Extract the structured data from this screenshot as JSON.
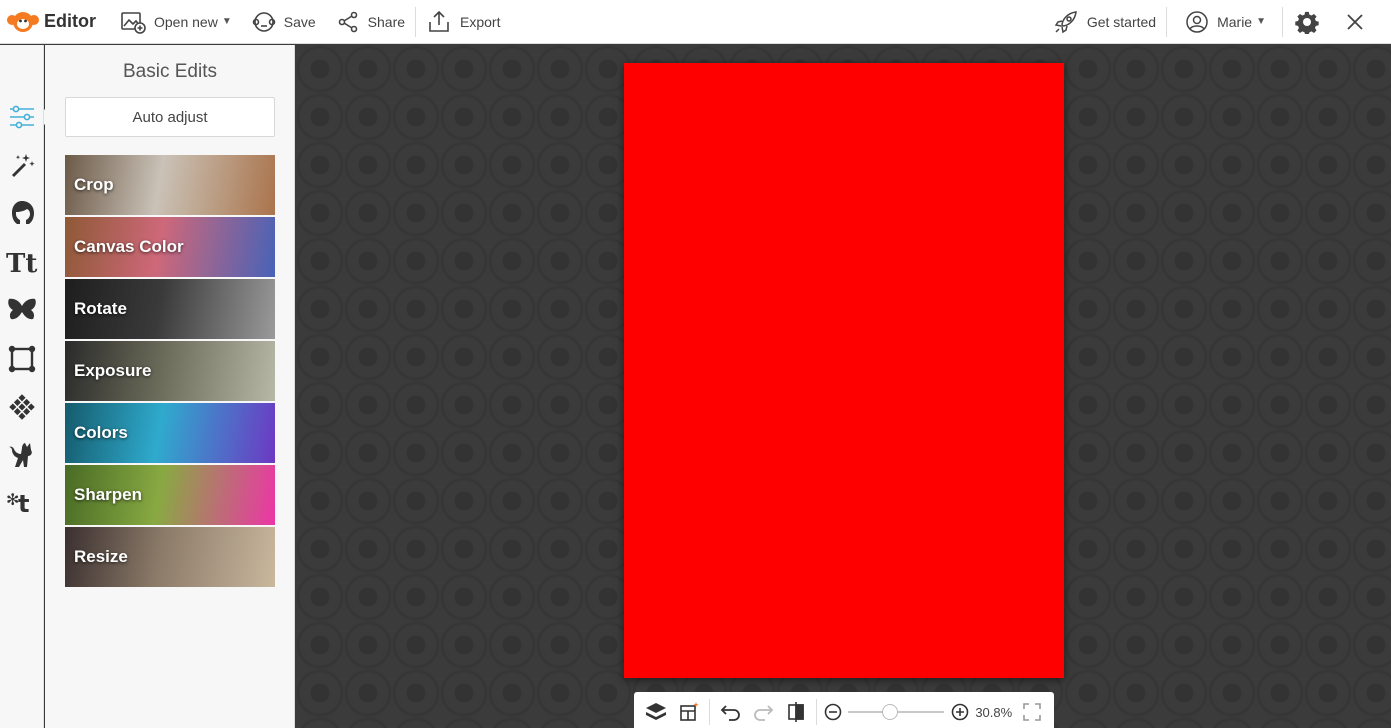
{
  "app": {
    "title": "Editor",
    "brand_color": "#f47b20",
    "accent_color": "#45b0d8"
  },
  "topbar": {
    "open_new_label": "Open new",
    "save_label": "Save",
    "share_label": "Share",
    "export_label": "Export",
    "get_started_label": "Get started",
    "user_label": "Marie"
  },
  "rail": {
    "items": [
      {
        "name": "basic-edits",
        "icon": "sliders-icon",
        "active": true
      },
      {
        "name": "effects",
        "icon": "magic-wand-icon"
      },
      {
        "name": "touch-up",
        "icon": "face-icon"
      },
      {
        "name": "text",
        "icon": "text-icon"
      },
      {
        "name": "graphics",
        "icon": "butterfly-icon"
      },
      {
        "name": "frames",
        "icon": "frame-icon"
      },
      {
        "name": "textures",
        "icon": "texture-icon"
      },
      {
        "name": "themes",
        "icon": "cat-icon"
      },
      {
        "name": "more",
        "icon": "plugin-icon"
      }
    ]
  },
  "panel": {
    "title": "Basic Edits",
    "auto_adjust_label": "Auto adjust",
    "tiles": [
      {
        "label": "Crop",
        "colors": [
          "#6b5a4a",
          "#c9c2b8",
          "#a67550"
        ]
      },
      {
        "label": "Canvas Color",
        "colors": [
          "#8a5a3a",
          "#c76a7a",
          "#4a62b0"
        ]
      },
      {
        "label": "Rotate",
        "colors": [
          "#1e1e1e",
          "#3a3a3a",
          "#9a9a9a"
        ]
      },
      {
        "label": "Exposure",
        "colors": [
          "#2a2a2a",
          "#6a6a5a",
          "#b8b8a8"
        ]
      },
      {
        "label": "Colors",
        "colors": [
          "#1a5a6a",
          "#38a8c8",
          "#6a3ab8"
        ]
      },
      {
        "label": "Sharpen",
        "colors": [
          "#4a6a2a",
          "#8aa84a",
          "#e03aa0"
        ]
      },
      {
        "label": "Resize",
        "colors": [
          "#3a3030",
          "#8a7a6a",
          "#c8b8a0"
        ]
      }
    ]
  },
  "canvas": {
    "fill_color": "#ff0000"
  },
  "bottombar": {
    "zoom_value": "30.8%",
    "zoom_fraction": 0.42
  }
}
